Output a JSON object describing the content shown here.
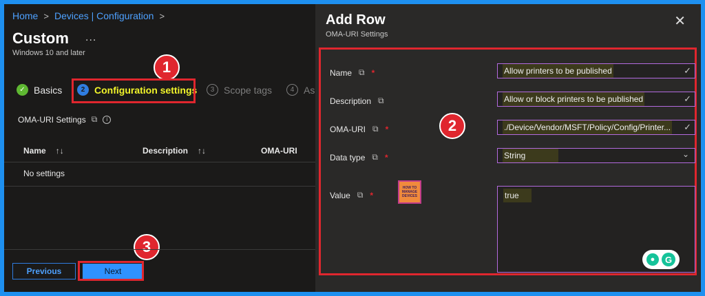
{
  "breadcrumb": {
    "items": [
      "Home",
      "Devices | Configuration"
    ],
    "sep": ">"
  },
  "page": {
    "title": "Custom",
    "more": "...",
    "subtitle": "Windows 10 and later"
  },
  "steps": [
    {
      "num": "✓",
      "label": "Basics",
      "state": "done"
    },
    {
      "num": "2",
      "label": "Configuration settings",
      "state": "current"
    },
    {
      "num": "3",
      "label": "Scope tags",
      "state": "pending"
    },
    {
      "num": "4",
      "label": "As",
      "state": "pending"
    }
  ],
  "oma_settings": {
    "label": "OMA-URI Settings",
    "columns": [
      {
        "label": "Name",
        "sort": "↑↓"
      },
      {
        "label": "Description",
        "sort": "↑↓"
      },
      {
        "label": "OMA-URI",
        "sort": ""
      }
    ],
    "empty_text": "No settings"
  },
  "footer": {
    "previous_label": "Previous",
    "next_label": "Next"
  },
  "panel": {
    "title": "Add Row",
    "subtitle": "OMA-URI Settings",
    "close_icon": "✕",
    "fields": {
      "name": {
        "label": "Name",
        "value": "Allow printers to be published"
      },
      "description": {
        "label": "Description",
        "value": "Allow or block printers to be published"
      },
      "oma_uri": {
        "label": "OMA-URI",
        "value": "./Device/Vendor/MSFT/Policy/Config/Printer..."
      },
      "data_type": {
        "label": "Data type",
        "value": "String"
      },
      "value": {
        "label": "Value",
        "value": "true"
      }
    },
    "required_mark": "*"
  },
  "annotations": {
    "one": "1",
    "two": "2",
    "three": "3"
  },
  "watermark": {
    "logo_text": "HOW TO MANAGE DEVICES"
  },
  "colors": {
    "accent": "#2f92ff",
    "highlight_red": "#e0262e",
    "current_step": "#f2f52a",
    "input_border": "#b46be0"
  },
  "icons": {
    "copy": "copy-icon",
    "info": "info-icon",
    "check": "check-icon",
    "chevron": "chevron-down-icon"
  }
}
